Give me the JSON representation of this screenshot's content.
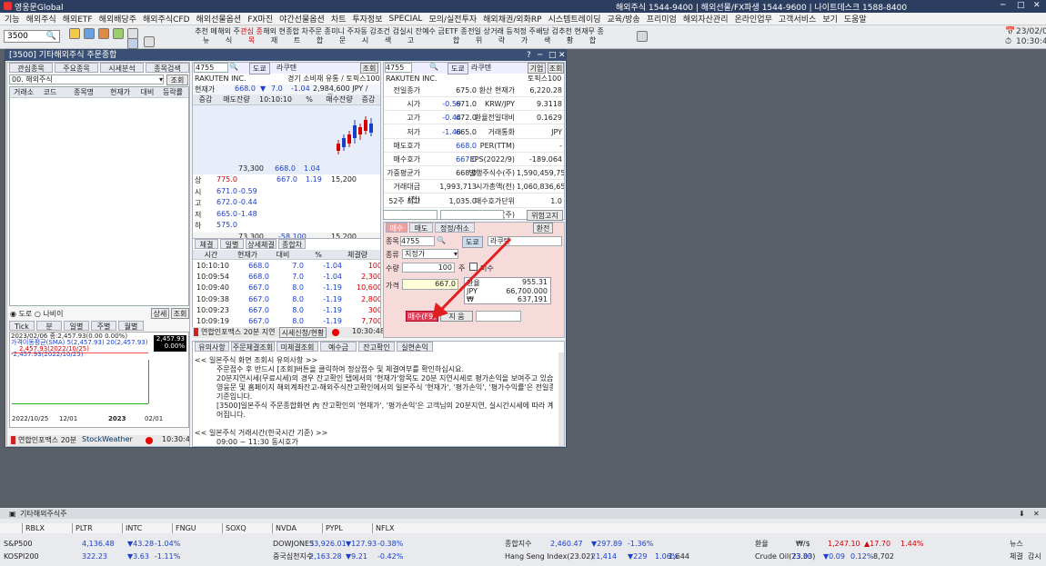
{
  "app": {
    "title": "영웅문Global",
    "hotlines": "해외주식 1544-9400 | 해외선물/FX파생 1544-9600 | 나이트데스크 1588-8400",
    "date": "23/02/06",
    "time": "10:30:49"
  },
  "menu": [
    "기능",
    "해외주식",
    "해외ETF",
    "해외배당주",
    "해외주식CFD",
    "해외선물옵션",
    "FX마진",
    "야간선물옵션",
    "차트",
    "투자정보",
    "SPECIAL",
    "모의/실전투자",
    "해외채권/외화RP",
    "시스템트레이딩",
    "교육/방송",
    "프리미엄",
    "해외자산관리",
    "온라인업무",
    "고객서비스",
    "보기",
    "도움말"
  ],
  "toolbar": {
    "screen_no": "3500",
    "buttons": [
      "추천 메뉴",
      "해외 주식",
      "관심 종목",
      "해외 현재",
      "종합 차트",
      "주문 종합",
      "미니 주문",
      "자동 감시",
      "조건 검색",
      "실시 잔고",
      "예수 금",
      "ETF 종합",
      "전일 상위",
      "거래 등락",
      "적정 주가",
      "배당 검색",
      "추천 현황",
      "재무 종합"
    ]
  },
  "window": {
    "title": "[3500] 기타해외주식 주문종합"
  },
  "left": {
    "tabs": [
      "관심종목",
      "주요종목",
      "시세분석",
      "종목검색"
    ],
    "group": "00. 해외주식",
    "lookup": "조회",
    "cols": [
      "거래소",
      "코드",
      "종목명",
      "현재가",
      "대비",
      "등락률"
    ],
    "radio1": "도로",
    "radio2": "나비이",
    "btn1": "상세",
    "btn2": "조회",
    "periods": [
      "Tick",
      "분",
      "일별",
      "주별",
      "월별"
    ],
    "chart_info": "2023/02/06 종:2,457.93(0.00 0.00%)",
    "ma_label": "가격이동평균(SMA) 5(2,457.93) 20(2,457.93)",
    "ma_v1": "2,457.93(2022/10/25)",
    "ma_v2": "-2,457.93(2022/10/25)",
    "price_box": "2,457.93",
    "pct_box": "0.00%",
    "xticks": [
      "2022/10/25",
      "12/01",
      "2023",
      "02/01"
    ],
    "footer_brand": "연합인포맥스 20분",
    "footer_brand2": "StockWeather",
    "footer_time": "10:30:49"
  },
  "quote": {
    "code": "4755",
    "mkt": "도쿄",
    "name": "라쿠텐",
    "lookup": "조회",
    "ename": "RAKUTEN INC.",
    "sector": "경기 소비재 유통 / 토픽스100",
    "cur_label": "현재가",
    "cur": "668.0",
    "chg": "7.0",
    "pct": "-1.04",
    "vol": "2,984,600 JPY / 100주",
    "hdr": [
      "증감",
      "매도잔량",
      "10:10:10",
      "%",
      "매수잔량",
      "증감"
    ],
    "ask_total": "73,300",
    "ask_px": "668.0",
    "ask_pct": "1.04",
    "bid_row": {
      "px": "667.0",
      "pct": "1.19",
      "qty": "15,200"
    },
    "side": [
      {
        "k": "상",
        "v": "775.0",
        "c": ""
      },
      {
        "k": "시",
        "v": "671.0",
        "c": "-0.59"
      },
      {
        "k": "고",
        "v": "672.0",
        "c": "-0.44"
      },
      {
        "k": "저",
        "v": "665.0",
        "c": "-1.48"
      },
      {
        "k": "하",
        "v": "575.0",
        "c": ""
      }
    ],
    "tot_ask": "73,300",
    "tot_diff": "-58,100",
    "tot_bid": "15,200",
    "footer": "연합인포맥스 20분 지연",
    "footer_btn": "시세신청/현황",
    "footer_time": "10:30:48"
  },
  "trades": {
    "tabs": [
      "체결",
      "일별",
      "상세체결",
      "종합차트"
    ],
    "cols": [
      "시간",
      "현재가",
      "대비",
      "%",
      "체결량"
    ],
    "rows": [
      [
        "10:10:10",
        "668.0",
        "7.0",
        "-1.04",
        "100"
      ],
      [
        "10:09:54",
        "668.0",
        "7.0",
        "-1.04",
        "2,300"
      ],
      [
        "10:09:40",
        "667.0",
        "8.0",
        "-1.19",
        "10,600"
      ],
      [
        "10:09:38",
        "667.0",
        "8.0",
        "-1.19",
        "2,800"
      ],
      [
        "10:09:23",
        "667.0",
        "8.0",
        "-1.19",
        "300"
      ],
      [
        "10:09:19",
        "667.0",
        "8.0",
        "-1.19",
        "7,700"
      ]
    ]
  },
  "info": {
    "code": "4755",
    "mkt": "도쿄",
    "name": "라쿠텐",
    "btn1": "기업",
    "btn2": "조회",
    "ename": "RAKUTEN INC.",
    "idx": "토픽스100",
    "rows": [
      [
        "전일종가",
        "675.0",
        "환산 현재가",
        "6,220.28"
      ],
      [
        "시가",
        "671.0",
        "-0.59",
        "KRW/JPY",
        "9.3118"
      ],
      [
        "고가",
        "672.0",
        "-0.44",
        "환율전일대비",
        "0.1629"
      ],
      [
        "저가",
        "665.0",
        "-1.48",
        "거래통화",
        "JPY"
      ],
      [
        "매도호가",
        "668.0",
        "PER(TTM)",
        "-"
      ],
      [
        "매수호가",
        "667.0",
        "EPS(2022/9)",
        "-189.064"
      ],
      [
        "가중평균가",
        "668.0",
        "발행주식수(주)",
        "1,590,459,756"
      ],
      [
        "거래대금(천)",
        "1,993,713",
        "시가총액(천)",
        "1,060,836,657"
      ],
      [
        "52주 최고",
        "1,035.0",
        "매수호가단위",
        "1.0"
      ],
      [
        "52주 최저",
        "576.0",
        "거래단위(주)",
        "100"
      ]
    ],
    "risk": "위험고지"
  },
  "order": {
    "tabs": [
      "매수",
      "매도",
      "정정/취소"
    ],
    "refresh": "환전",
    "code": "4755",
    "mkt": "도쿄",
    "name": "라쿠텐",
    "type_label": "종류",
    "type_val": "지정가",
    "qty_label": "수량",
    "qty_val": "100",
    "qty_unit": "주",
    "chk": "미수",
    "price_label": "가격",
    "price_val": "667.0",
    "fx": [
      [
        "환율",
        "955.31"
      ],
      [
        "JPY",
        "66,700.000"
      ],
      [
        "₩",
        "637,191"
      ]
    ],
    "submit": "매수(F9)",
    "clear": "지 움"
  },
  "notice": {
    "tabs": [
      "유의사항",
      "주문체결조회",
      "미체결조회",
      "예수금",
      "잔고확인",
      "실현손익"
    ],
    "lines": [
      "<< 일본주식 화면 조회시 유의사항 >>",
      "주문접수 후 반드시 [조회]버튼을 클릭하여 정상접수 및 체결여부를 확인하십시요.",
      "20분지연시세(무료시세)의 경우 잔고확인 탭에서의 '현재가'항목도 20분 지연시세로 평가손익을 보여주고 있습니다.",
      "영웅문 및 홈페이지 해외계좌잔고-해외주식잔고확인에서의 일본주식 '현재가', '평가손익', '평가수익률'은 전일종가",
      "기준입니다.",
      "[3500]일본주식 주문종합화면 內 잔고확인의 '현재가', '평가손익'은 고객님의 20분지연, 실시간시세에 따라 계산되",
      "어집니다.",
      "",
      "<< 일본주식 거래시간(한국시간 기준) >>",
      "09:00 ~ 11:30 동시호가"
    ]
  },
  "bottom": {
    "title": "기타해외주식주",
    "tickers": [
      "RBLX",
      "PLTR",
      "INTC",
      "FNGU",
      "SOXQ",
      "NVDA",
      "PYPL",
      "NFLX"
    ],
    "row1": [
      [
        "S&P500",
        "4,136.48",
        "▼43.28",
        "-1.04%"
      ],
      [
        "DOWJONES",
        "33,926.01",
        "▼127.93",
        "-0.38%"
      ],
      [
        "종합지수",
        "2,460.47",
        "▼297.89",
        "-1.36%"
      ],
      [
        "환율",
        "₩/$",
        "1,247.10",
        "▲17.70",
        "1.44%"
      ]
    ],
    "row2": [
      [
        "KOSPI200",
        "322.23",
        "▼3.63",
        "-1.11%"
      ],
      [
        "중국심천지수",
        "2,163.28",
        "▼9.21",
        "-0.42%"
      ],
      [
        "Hang Seng Index(23.02)",
        "21,414",
        "▼229",
        "1.06%",
        "1,644"
      ],
      [
        "Crude Oil(23.03)",
        "73.30",
        "▼0.09",
        "0.12%",
        "8,702"
      ]
    ],
    "news": "뉴스",
    "chat": "체결",
    "watch": "감시"
  }
}
